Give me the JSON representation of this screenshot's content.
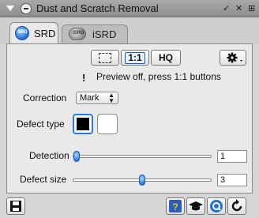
{
  "window": {
    "title": "Dust and Scratch Removal",
    "controls": [
      "✓",
      "✕",
      "⊞"
    ]
  },
  "tabs": [
    {
      "label": "SRD",
      "logo": "SRD",
      "active": true
    },
    {
      "label": "iSRD",
      "logo": "iSRD",
      "active": false
    }
  ],
  "toolbar": {
    "zoom_label": "1:1",
    "hq_label": "HQ"
  },
  "warning": {
    "icon": "!",
    "text": "Preview off, press 1:1 buttons"
  },
  "correction": {
    "label": "Correction",
    "value": "Mark"
  },
  "defect_type": {
    "label": "Defect type",
    "selected": "black"
  },
  "detection": {
    "label": "Detection",
    "value": "1",
    "level": 0.0
  },
  "defect_size": {
    "label": "Defect size",
    "value": "3",
    "level": 0.5
  },
  "colors": {
    "accent": "#2c7be0",
    "panel": "#e9e9e9",
    "background": "#d6d6d6"
  },
  "footer": {
    "icons": [
      "save-icon",
      "help-icon",
      "graduation-cap-icon",
      "qc-icon",
      "reset-icon"
    ]
  }
}
